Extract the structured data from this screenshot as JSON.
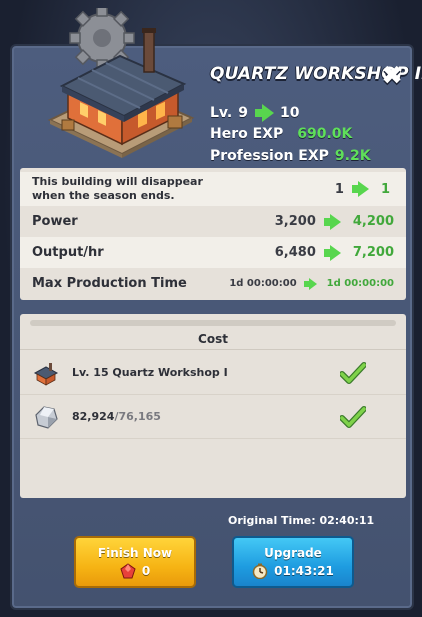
{
  "header": {
    "title": "QUARTZ WORKSHOP II",
    "close_symbol": "✖",
    "level_prefix": "Lv.",
    "level_from": "9",
    "level_to": "10",
    "hero_exp_label": "Hero EXP",
    "hero_exp_value": "690.0K",
    "profession_exp_label": "Profession EXP",
    "profession_exp_value": "9.2K"
  },
  "info": {
    "notice": "This building will disappear when the season ends.",
    "notice_from": "1",
    "notice_to": "1",
    "power_label": "Power",
    "power_from": "3,200",
    "power_to": "4,200",
    "output_label": "Output/hr",
    "output_from": "6,480",
    "output_to": "7,200",
    "maxtime_label": "Max Production Time",
    "maxtime_from": "1d 00:00:00",
    "maxtime_to": "1d 00:00:00"
  },
  "cost": {
    "header": "Cost",
    "items": [
      {
        "icon": "workshop-icon",
        "label": "Lv. 15 Quartz Workshop I",
        "met": true
      },
      {
        "icon": "quartz-icon",
        "have": "82,924",
        "need": "/76,165",
        "met": true
      }
    ]
  },
  "footer": {
    "original_time": "Original Time: 02:40:11",
    "finish_label": "Finish Now",
    "finish_cost": "0",
    "upgrade_label": "Upgrade",
    "upgrade_time": "01:43:21"
  },
  "colors": {
    "accent_green": "#5fe05a",
    "finish_button": "#f6b414",
    "upgrade_button": "#1e9ce0"
  }
}
